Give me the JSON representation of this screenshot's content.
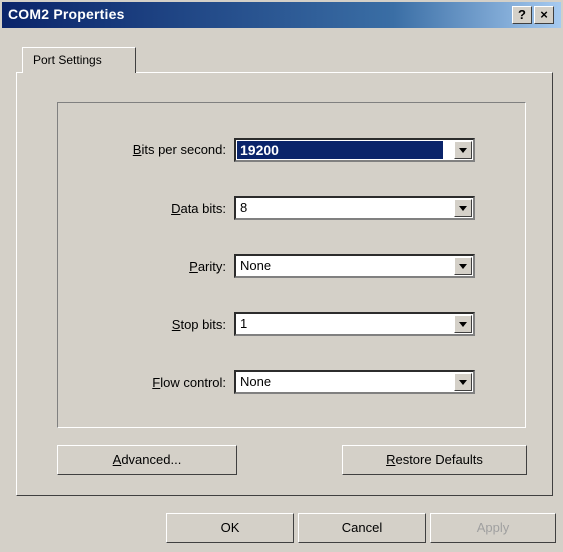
{
  "window": {
    "title": "COM2 Properties",
    "help_glyph": "?",
    "close_glyph": "×"
  },
  "tabs": [
    {
      "label": "Port Settings"
    }
  ],
  "fields": {
    "bits_per_second": {
      "label_first": "B",
      "label_rest": "its per second:",
      "value": "19200"
    },
    "data_bits": {
      "label_first": "D",
      "label_rest": "ata bits:",
      "value": "8"
    },
    "parity": {
      "label_first": "P",
      "label_rest": "arity:",
      "value": "None"
    },
    "stop_bits": {
      "label_first": "S",
      "label_rest": "top bits:",
      "value": "1"
    },
    "flow_control": {
      "label_first": "F",
      "label_rest": "low control:",
      "value": "None"
    }
  },
  "buttons": {
    "advanced": {
      "first": "A",
      "rest": "dvanced..."
    },
    "restore": {
      "first": "R",
      "rest": "estore Defaults"
    },
    "ok": "OK",
    "cancel": "Cancel",
    "apply": "Apply"
  },
  "colors": {
    "titlebar": "#0a246a",
    "face": "#d4d0c8",
    "selection": "#0a246a"
  }
}
